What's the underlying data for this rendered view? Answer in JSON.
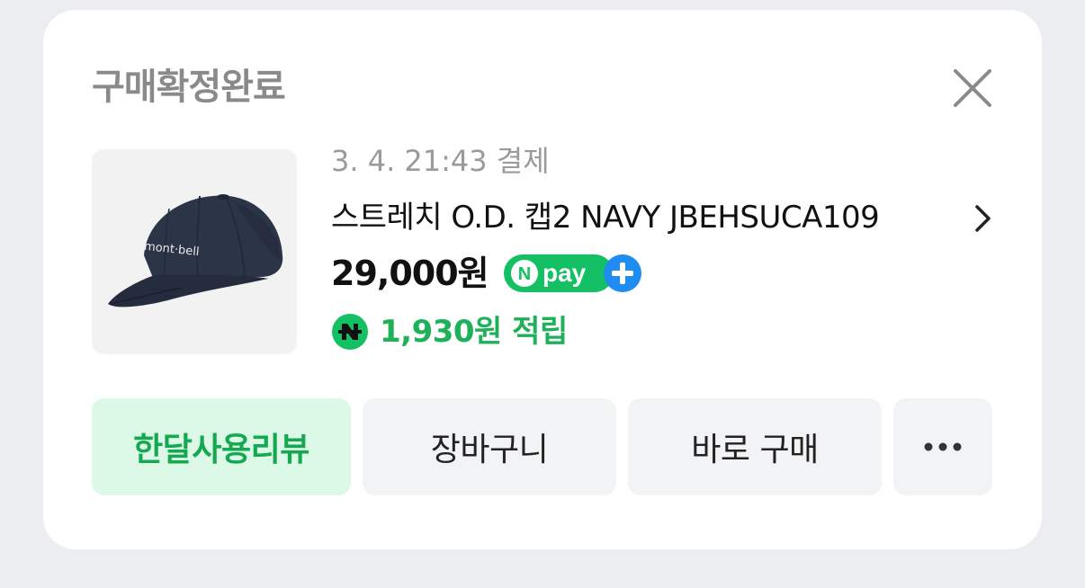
{
  "dialog": {
    "title": "구매확정완료"
  },
  "order": {
    "pay_date": "3. 4. 21:43 결제",
    "product_name": "스트레치 O.D. 캡2 NAVY JBEHSUCA109",
    "price": "29,000원",
    "payment_badge": "Npay+",
    "payment_badge_letter": "N",
    "payment_badge_word": "pay",
    "reward": "1,930원 적립",
    "product_image_logo": "mont·bell"
  },
  "actions": {
    "review_label": "한달사용리뷰",
    "cart_label": "장바구니",
    "buy_label": "바로 구매"
  },
  "colors": {
    "accent_green": "#1eb15a",
    "review_bg": "#dcf8e6",
    "button_bg": "#f1f3f5",
    "npay_green": "#14c064",
    "npay_blue": "#1e8cf0"
  },
  "icons": {
    "close": "close-icon",
    "chevron": "chevron-right-icon",
    "more": "more-icon",
    "reward": "naver-points-icon"
  }
}
